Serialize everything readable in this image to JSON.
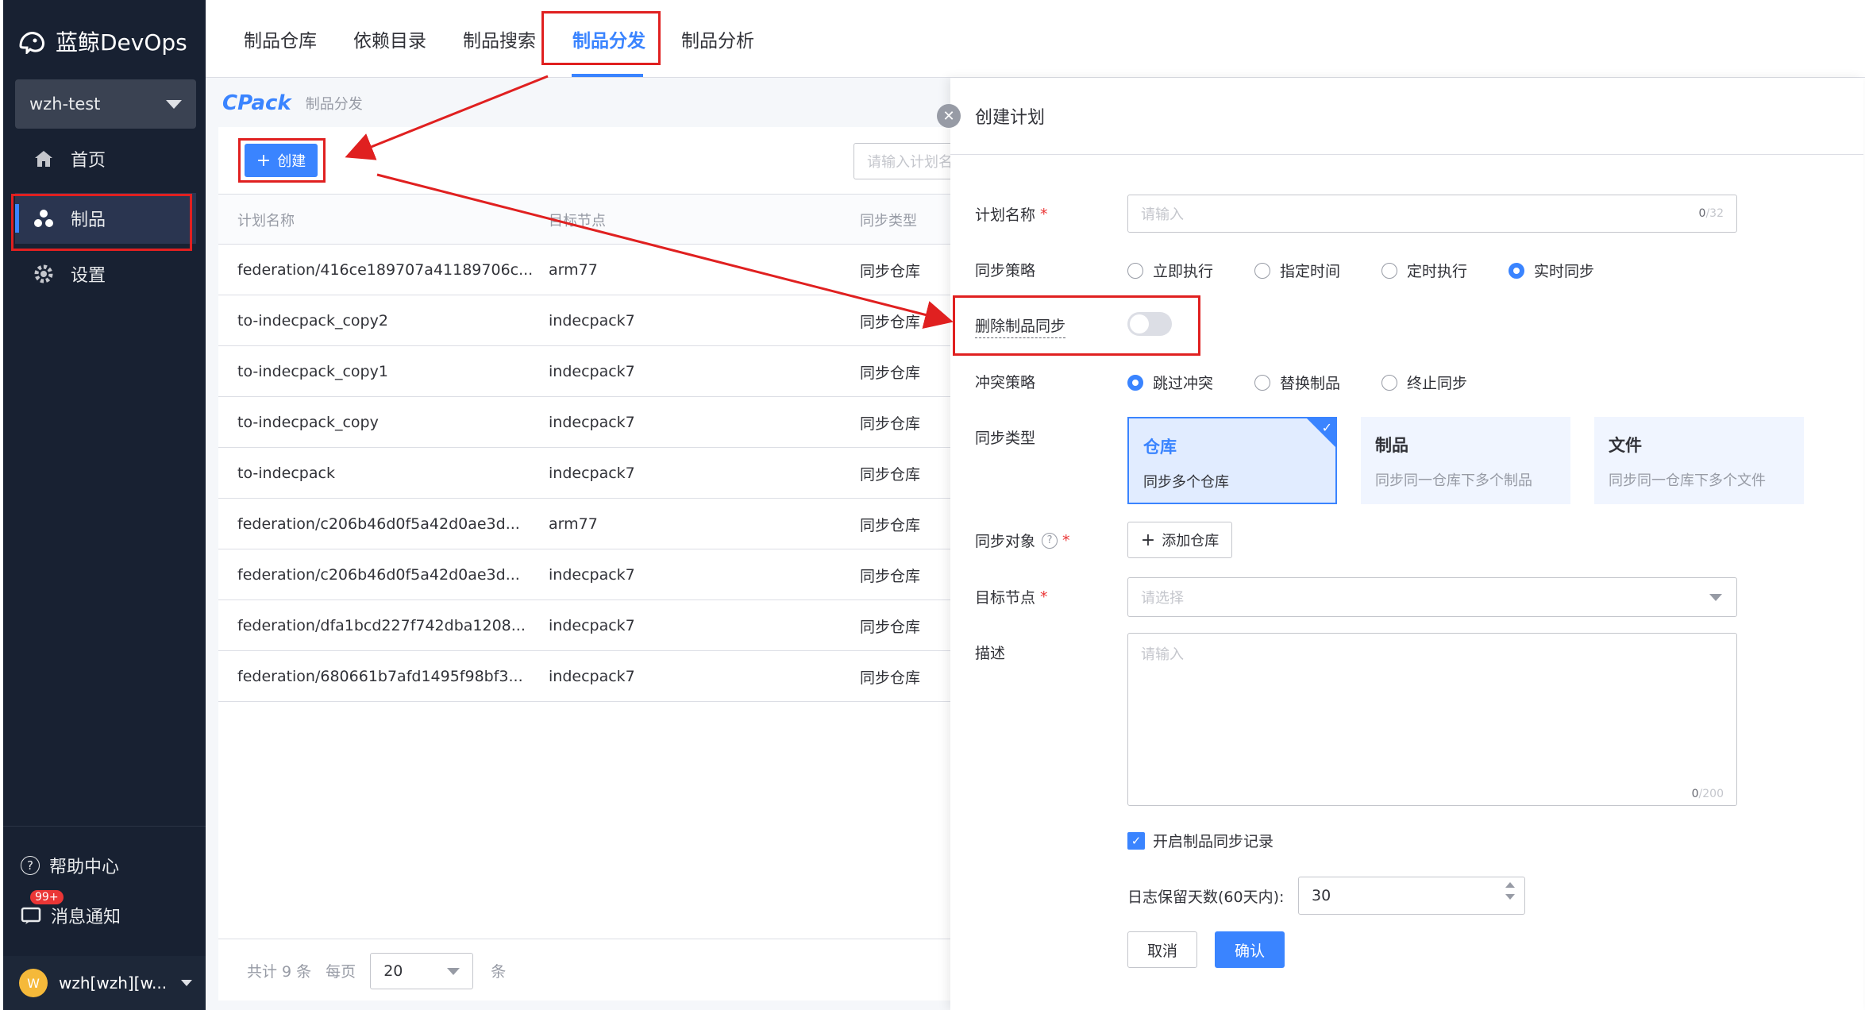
{
  "brand": {
    "name": "蓝鲸DevOps"
  },
  "project": {
    "name": "wzh-test"
  },
  "sidebar": {
    "items": [
      {
        "label": "首页",
        "icon": "home-icon"
      },
      {
        "label": "制品",
        "icon": "artifact-icon",
        "active": true
      },
      {
        "label": "设置",
        "icon": "gear-icon"
      }
    ],
    "help": "帮助中心",
    "notify": "消息通知",
    "notify_badge": "99+",
    "user": "wzh[wzh][w...",
    "user_initial": "W"
  },
  "topnav": {
    "tabs": [
      {
        "label": "制品仓库"
      },
      {
        "label": "依赖目录"
      },
      {
        "label": "制品搜索"
      },
      {
        "label": "制品分发",
        "active": true
      },
      {
        "label": "制品分析"
      }
    ]
  },
  "breadcrumb": {
    "logo": "CPack",
    "page": "制品分发"
  },
  "list": {
    "create_label": "创建",
    "search_placeholder": "请输入计划名",
    "columns": [
      "计划名称",
      "目标节点",
      "同步类型"
    ],
    "rows": [
      [
        "federation/416ce189707a41189706c...",
        "arm77",
        "同步仓库"
      ],
      [
        "to-indecpack_copy2",
        "indecpack7",
        "同步仓库"
      ],
      [
        "to-indecpack_copy1",
        "indecpack7",
        "同步仓库"
      ],
      [
        "to-indecpack_copy",
        "indecpack7",
        "同步仓库"
      ],
      [
        "to-indecpack",
        "indecpack7",
        "同步仓库"
      ],
      [
        "federation/c206b46d0f5a42d0ae3d...",
        "arm77",
        "同步仓库"
      ],
      [
        "federation/c206b46d0f5a42d0ae3d...",
        "indecpack7",
        "同步仓库"
      ],
      [
        "federation/dfa1bcd227f742dba1208...",
        "indecpack7",
        "同步仓库"
      ],
      [
        "federation/680661b7afd1495f98bf3...",
        "indecpack7",
        "同步仓库"
      ]
    ],
    "pager": {
      "total": "共计 9 条",
      "per_page_label": "每页",
      "per_page": "20",
      "unit": "条"
    }
  },
  "panel": {
    "title": "创建计划",
    "fields": {
      "name": {
        "label": "计划名称",
        "placeholder": "请输入",
        "count": "0",
        "max": "/32"
      },
      "strategy": {
        "label": "同步策略",
        "options": [
          "立即执行",
          "指定时间",
          "定时执行",
          "实时同步"
        ],
        "selected": 3
      },
      "delete_sync": {
        "label": "删除制品同步",
        "enabled": false
      },
      "conflict": {
        "label": "冲突策略",
        "options": [
          "跳过冲突",
          "替换制品",
          "终止同步"
        ],
        "selected": 0
      },
      "sync_type": {
        "label": "同步类型",
        "cards": [
          {
            "title": "仓库",
            "desc": "同步多个仓库",
            "selected": true
          },
          {
            "title": "制品",
            "desc": "同步同一仓库下多个制品"
          },
          {
            "title": "文件",
            "desc": "同步同一仓库下多个文件"
          }
        ]
      },
      "target": {
        "label": "同步对象",
        "add_label": "添加仓库"
      },
      "node": {
        "label": "目标节点",
        "placeholder": "请选择"
      },
      "desc": {
        "label": "描述",
        "placeholder": "请输入",
        "count": "0",
        "max": "/200"
      },
      "record": {
        "label": "开启制品同步记录",
        "checked": true
      },
      "retention": {
        "label": "日志保留天数(60天内):",
        "value": "30"
      }
    },
    "cancel_label": "取消",
    "confirm_label": "确认"
  },
  "colors": {
    "primary": "#3a84ff",
    "sidebar_bg": "#182132",
    "annotation": "#e02020"
  }
}
